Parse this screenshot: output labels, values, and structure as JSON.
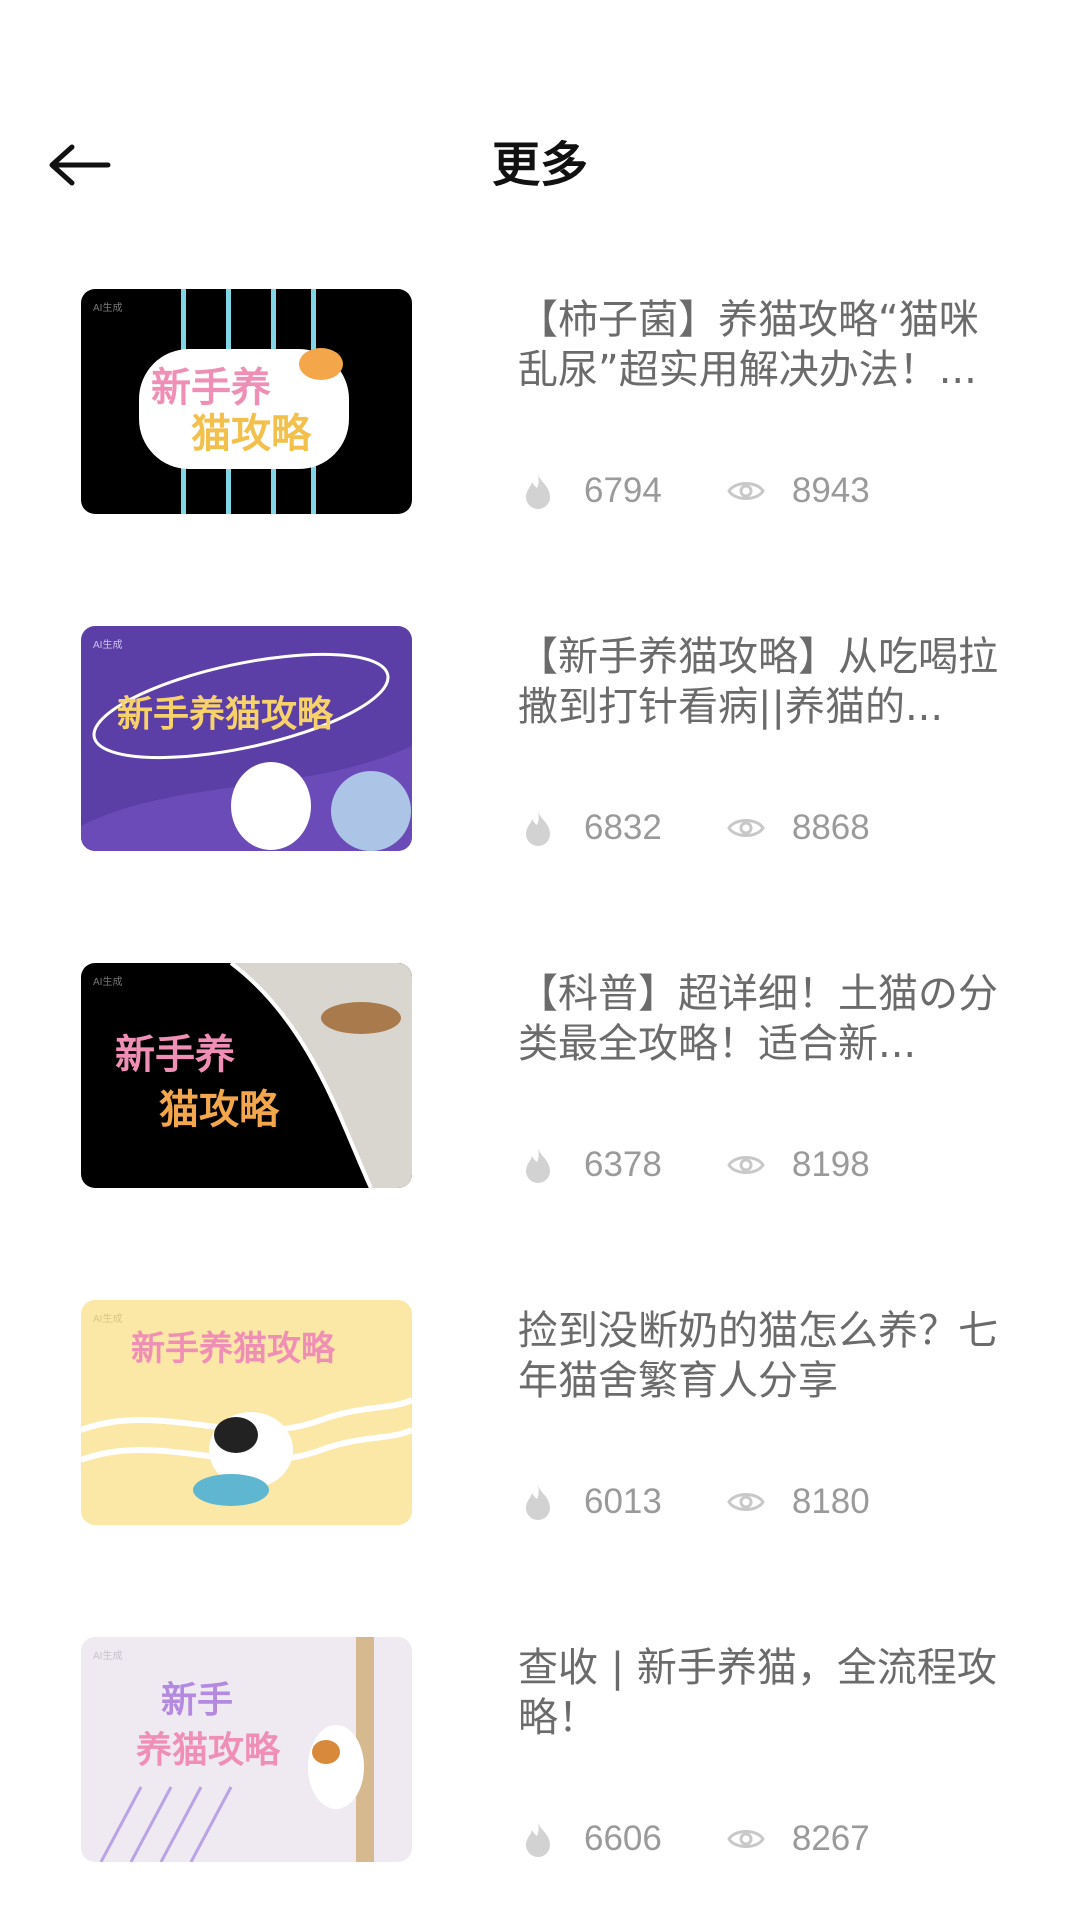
{
  "header": {
    "title": "更多"
  },
  "colors": {
    "title_text": "#6b6b6b",
    "stat_text": "#9a9a9a",
    "icon": "#c8c8c8"
  },
  "items": [
    {
      "title": "【柿子菌】养猫攻略“猫咪乱尿”超实用解决办法！...",
      "likes": "6794",
      "views": "8943",
      "thumb_text": [
        "新手养",
        "猫攻略"
      ],
      "thumb_badge": "AI生成"
    },
    {
      "title": "【新手养猫攻略】从吃喝拉撒到打针看病||养猫的...",
      "likes": "6832",
      "views": "8868",
      "thumb_text": [
        "新手养猫攻略"
      ],
      "thumb_badge": "AI生成"
    },
    {
      "title": "【科普】超详细！土猫の分类最全攻略！适合新...",
      "likes": "6378",
      "views": "8198",
      "thumb_text": [
        "新手养",
        "猫攻略"
      ],
      "thumb_badge": "AI生成"
    },
    {
      "title": "捡到没断奶的猫怎么养？七年猫舍繁育人分享",
      "likes": "6013",
      "views": "8180",
      "thumb_text": [
        "新手养猫攻略"
      ],
      "thumb_badge": "AI生成"
    },
    {
      "title": "查收 | 新手养猫，全流程攻略！",
      "likes": "6606",
      "views": "8267",
      "thumb_text": [
        "新手",
        "养猫攻略"
      ],
      "thumb_badge": "AI生成"
    }
  ]
}
